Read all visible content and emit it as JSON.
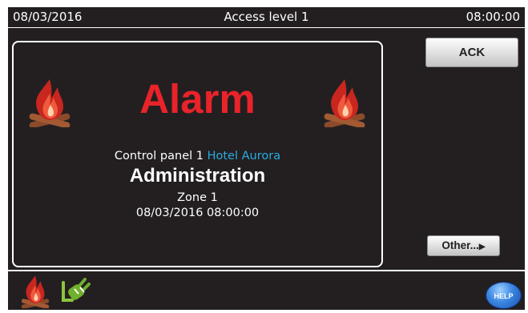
{
  "status_bar": {
    "date": "08/03/2016",
    "access_level": "Access level 1",
    "time": "08:00:00"
  },
  "alarm": {
    "title": "Alarm",
    "panel_prefix": "Control panel 1",
    "panel_name": "Hotel Aurora",
    "area": "Administration",
    "zone": "Zone 1",
    "timestamp": "08/03/2016 08:00:00",
    "icon": "fire-icon"
  },
  "buttons": {
    "ack": "ACK",
    "other": "Other...",
    "help": "HELP"
  },
  "bottom_bar": {
    "icons": [
      "fire-icon",
      "plug-icon"
    ]
  },
  "colors": {
    "screen_background": "#231f20",
    "alarm_text": "#e8232a",
    "panel_name": "#29abe2"
  }
}
